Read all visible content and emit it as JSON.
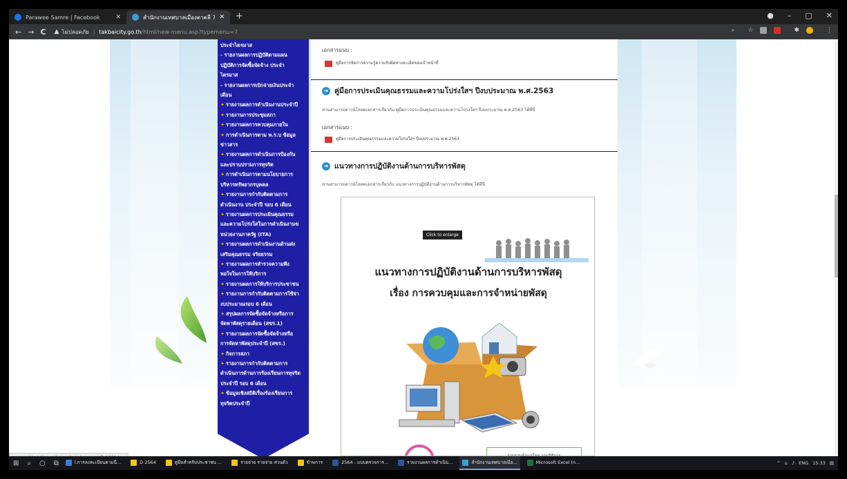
{
  "browser": {
    "tabs": [
      {
        "label": "Parawee Samre | Facebook",
        "favicon_color": "#1877f2"
      },
      {
        "label": "สำนักงานเทศบาลเมืองตาคลี 7/55 ห...",
        "favicon_color": "#3aa0d8"
      }
    ],
    "new_tab": "+",
    "window_controls": [
      "●",
      "–",
      "▢",
      "✕"
    ],
    "nav": {
      "back": "←",
      "forward": "→",
      "reload": "C"
    },
    "address": {
      "security_label": "ไม่ปลอดภัย",
      "host": "takbaicity.go.th",
      "path": "/html/new-menu.asp?typemenu=7"
    }
  },
  "sidemenu": {
    "items": [
      {
        "text": "ประจำไตรมาส",
        "diamond": false
      },
      {
        "text": " - รายงานผลการปฏิบัติตามแผน",
        "diamond": false
      },
      {
        "text": "ปฏิบัติการจัดซื้อจัดจ้าง ประจำ",
        "diamond": false
      },
      {
        "text": "ไตรมาส",
        "diamond": false
      },
      {
        "text": " - รายงานผลการเบิกจ่ายเงินประจำ",
        "diamond": false
      },
      {
        "text": "เดือน",
        "diamond": false
      },
      {
        "text": "รายงานผลการดำเนินงานประจำปี",
        "diamond": true
      },
      {
        "text": "รายงานการประชุมสภา",
        "diamond": true
      },
      {
        "text": "รายงานผลการควบคุมภายใน",
        "diamond": true
      },
      {
        "text": "การดำเนินการตาม พ.ร.บ ข้อมูล",
        "diamond": true
      },
      {
        "text": "ข่าวสาร",
        "diamond": false
      },
      {
        "text": "รายงานผลการดำเนินการป้องกัน",
        "diamond": true
      },
      {
        "text": "และปราบปรามการทุจริต",
        "diamond": false
      },
      {
        "text": "การดำเนินการตามนโยบายการ",
        "diamond": true
      },
      {
        "text": "บริหารทรัพยากรบุคคล",
        "diamond": false
      },
      {
        "text": "รายงานการกำกับติดตามการ",
        "diamond": true
      },
      {
        "text": "ดำเนินงาน ประจำปี รอบ 6 เดือน",
        "diamond": false
      },
      {
        "text": "รายงานผลการประเมินคุณธรรม",
        "diamond": true
      },
      {
        "text": "และความโปร่งใสในการดำเนินงานข",
        "diamond": false
      },
      {
        "text": "หน่วยงานภาครัฐ (ITA)",
        "diamond": false
      },
      {
        "text": "รายงานผลการดำเนินงานด้านส่ง",
        "diamond": true
      },
      {
        "text": "เสริมคุณธรรม จริยธรรม",
        "diamond": false
      },
      {
        "text": "รายงานผลการสำรวจความพึง",
        "diamond": true
      },
      {
        "text": "พอใจในการให้บริการ",
        "diamond": false
      },
      {
        "text": "รายงานผลการให้บริการประชาชน",
        "diamond": true
      },
      {
        "text": "รายงานการกำกับติดตามการใช้จ่า",
        "diamond": true
      },
      {
        "text": "งบประมาณรอบ 6 เดือน",
        "diamond": false
      },
      {
        "text": "สรุปผลการจัดซื้อจัดจ้างหรือการ",
        "diamond": true
      },
      {
        "text": "จัดหาพัสดุรายเดือน (สขร.1)",
        "diamond": false
      },
      {
        "text": "รายงานผลการจัดซื้อจัดจ้างหรือ",
        "diamond": true
      },
      {
        "text": "การจัดหาพัสดุประจำปี (สขร.)",
        "diamond": false
      },
      {
        "text": "กิจการสภา",
        "diamond": true
      },
      {
        "text": "รายงานการกำกับติดตามการ",
        "diamond": true
      },
      {
        "text": "ดำเนินการด้านการร้องเรียนการทุจริต",
        "diamond": false
      },
      {
        "text": "ประจำปี รอบ 6 เดือน",
        "diamond": false
      },
      {
        "text": "ข้อมูลเชิงสถิติเรื่องร้องเรียนการ",
        "diamond": true
      },
      {
        "text": "ทุจริตประจำปี",
        "diamond": false
      }
    ]
  },
  "main": {
    "block1": {
      "attach_label": "เอกสารแนบ :",
      "file_name": "คู่มือการจัดการความรู้ความรับผิดทางละเมิดของเจ้าหน้าที่"
    },
    "block2": {
      "heading": "คู่มือการประเมินคุณธรรมและความโปร่งใสฯ ปีงบประมาณ พ.ศ.2563",
      "desc": "ท่านสามารถดาวน์โหลดเอกสารเกี่ยวกับ คู่มือการประเมินคุณธรรมและความโปร่งใสฯ ปีงบประมาณ พ.ศ.2563 ได้ที่นี่",
      "attach_label": "เอกสารแนบ :",
      "file_name": "คู่มือการประเมินคุณธรรมและความโปร่งใสฯ ปีงบประมาณ พ.ศ.2563"
    },
    "block3": {
      "heading": "แนวทางการปฏิบัติงานด้านการบริหารพัสดุ",
      "desc": "ท่านสามารถดาวน์โหลดเอกสารเกี่ยวกับ แนวทางการปฏิบัติงานด้านการบริหารพัสดุ ได้ที่นี่"
    },
    "preview": {
      "enlarge_label": "Click to enlarge",
      "title_line1": "แนวทางการปฏิบัติงานด้านการบริหารพัสดุ",
      "title_line2": "เรื่อง  การควบคุมและการจำหน่ายพัสดุ",
      "credit": "รวบรวมข้อมูลโดย  งานมิติการ"
    }
  },
  "status_url": "www.takbaicity.go.th/product_images/47-0001.jpg",
  "taskbar": {
    "apps": [
      {
        "label": "l.การลงทะเบียนตามนี...",
        "color": "#3b7dd8",
        "active": false
      },
      {
        "label": "D 2564",
        "color": "#f5c518",
        "active": false
      },
      {
        "label": "คู่มือสำหรับประชาชน ...",
        "color": "#f5c518",
        "active": false
      },
      {
        "label": "รายจ่าย รายจ่าย ส่วนตัว",
        "color": "#f5c518",
        "active": false
      },
      {
        "label": "ข้าพการ",
        "color": "#f5c518",
        "active": false
      },
      {
        "label": "2564 - แบบตรวจการ...",
        "color": "#2b579a",
        "active": false
      },
      {
        "label": "รายงานผลการดำเนิน...",
        "color": "#2b579a",
        "active": false
      },
      {
        "label": "สำนักงานเทศบาลเมือ...",
        "color": "#3aa0d8",
        "active": true
      },
      {
        "label": "Microsoft Excel (n...",
        "color": "#1e7145",
        "active": false
      }
    ],
    "tray": {
      "lang": "ENG",
      "time": "15:33"
    }
  }
}
